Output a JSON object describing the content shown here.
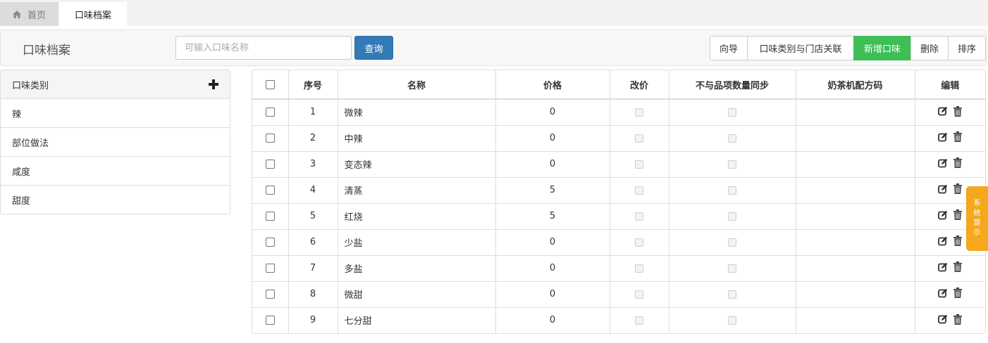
{
  "tabs": {
    "home": {
      "icon": "home-icon",
      "label": "首页"
    },
    "active": {
      "label": "口味档案"
    }
  },
  "toolbar": {
    "title": "口味档案",
    "search": {
      "placeholder": "可输入口味名称",
      "value": ""
    },
    "query_label": "查询",
    "buttons": {
      "guide": "向导",
      "link_store": "口味类别与门店关联",
      "add": "新增口味",
      "delete": "删除",
      "sort": "排序"
    }
  },
  "categories": {
    "header": "口味类别",
    "add_icon": "plus-icon",
    "items": [
      "辣",
      "部位做法",
      "咸度",
      "甜度"
    ]
  },
  "table": {
    "headers": {
      "seq": "序号",
      "name": "名称",
      "price": "价格",
      "modprice": "改价",
      "nosync": "不与品项数量同步",
      "code": "奶茶机配方码",
      "edit": "编辑"
    },
    "rows": [
      {
        "seq": "1",
        "name": "微辣",
        "price": "0",
        "code": ""
      },
      {
        "seq": "2",
        "name": "中辣",
        "price": "0",
        "code": ""
      },
      {
        "seq": "3",
        "name": "变态辣",
        "price": "0",
        "code": ""
      },
      {
        "seq": "4",
        "name": "清蒸",
        "price": "5",
        "code": ""
      },
      {
        "seq": "5",
        "name": "红烧",
        "price": "5",
        "code": ""
      },
      {
        "seq": "6",
        "name": "少盐",
        "price": "0",
        "code": ""
      },
      {
        "seq": "7",
        "name": "多盐",
        "price": "0",
        "code": ""
      },
      {
        "seq": "8",
        "name": "微甜",
        "price": "0",
        "code": ""
      },
      {
        "seq": "9",
        "name": "七分甜",
        "price": "0",
        "code": ""
      }
    ],
    "row_icons": [
      "edit-icon",
      "trash-icon"
    ]
  },
  "notice": {
    "label": "系统提示"
  },
  "colors": {
    "primary": "#337ab7",
    "success": "#3dbf55",
    "notice": "#f5a81c"
  }
}
